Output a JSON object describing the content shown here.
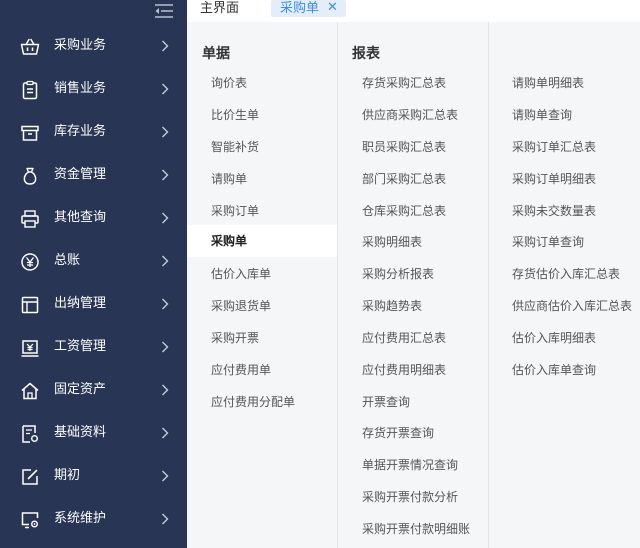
{
  "sidebar": {
    "items": [
      {
        "label": "采购业务",
        "icon": "basket-icon"
      },
      {
        "label": "销售业务",
        "icon": "clipboard-icon"
      },
      {
        "label": "库存业务",
        "icon": "inventory-box-icon"
      },
      {
        "label": "资金管理",
        "icon": "money-bag-icon"
      },
      {
        "label": "其他查询",
        "icon": "printer-icon"
      },
      {
        "label": "总账",
        "icon": "yen-circle-icon"
      },
      {
        "label": "出纳管理",
        "icon": "layout-icon"
      },
      {
        "label": "工资管理",
        "icon": "salary-icon"
      },
      {
        "label": "固定资产",
        "icon": "house-icon"
      },
      {
        "label": "基础资料",
        "icon": "document-settings-icon"
      },
      {
        "label": "期初",
        "icon": "edit-icon"
      },
      {
        "label": "系统维护",
        "icon": "monitor-gear-icon"
      }
    ]
  },
  "tabs": {
    "home": "主界面",
    "active": "采购单",
    "close_symbol": "✕"
  },
  "documents": {
    "heading": "单据",
    "items": [
      "询价表",
      "比价生单",
      "智能补货",
      "请购单",
      "采购订单",
      "采购单",
      "估价入库单",
      "采购退货单",
      "采购开票",
      "应付费用单",
      "应付费用分配单"
    ],
    "active_index": 5
  },
  "reports": {
    "heading": "报表",
    "col1": [
      "存货采购汇总表",
      "供应商采购汇总表",
      "职员采购汇总表",
      "部门采购汇总表",
      "仓库采购汇总表",
      "采购明细表",
      "采购分析报表",
      "采购趋势表",
      "应付费用汇总表",
      "应付费用明细表",
      "开票查询",
      "存货开票查询",
      "单据开票情况查询",
      "采购开票付款分析",
      "采购开票付款明细账"
    ],
    "col2": [
      "请购单明细表",
      "请购单查询",
      "采购订单汇总表",
      "采购订单明细表",
      "采购未交数量表",
      "采购订单查询",
      "存货估价入库汇总表",
      "供应商估价入库汇总表",
      "估价入库明细表",
      "估价入库单查询"
    ]
  },
  "colors": {
    "sidebar_bg": "#283554",
    "accent": "#3c8ee6",
    "content_bg": "#f5f6f8"
  }
}
